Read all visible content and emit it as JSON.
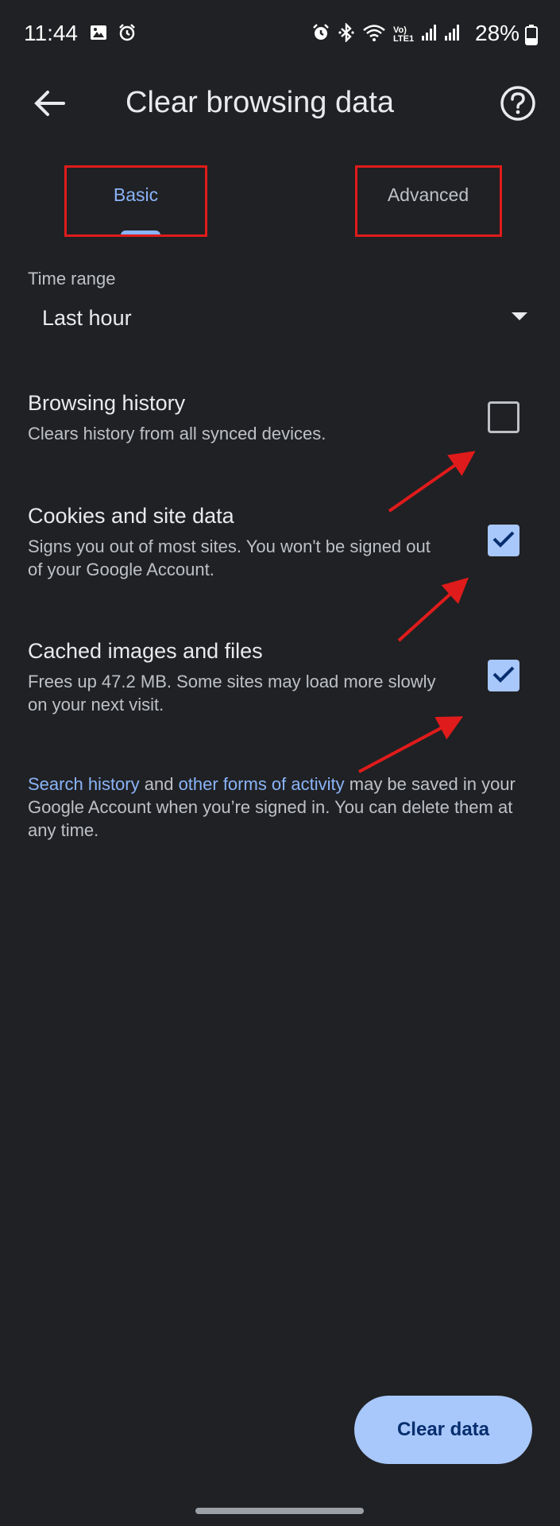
{
  "status_bar": {
    "time": "11:44",
    "battery": "28%",
    "network_label_top": "Vo)",
    "network_label_bottom": "LTE1",
    "left_icons": [
      "image-icon",
      "alarm-icon"
    ],
    "right_icons": [
      "alarm-icon",
      "bluetooth-icon",
      "wifi-icon",
      "signal-icon",
      "signal-icon",
      "battery-icon"
    ]
  },
  "app_bar": {
    "title": "Clear browsing data",
    "back_icon": "arrow-back-icon",
    "help_icon": "help-circle-icon"
  },
  "tabs": [
    {
      "label": "Basic",
      "selected": true
    },
    {
      "label": "Advanced",
      "selected": false
    }
  ],
  "time_range": {
    "label": "Time range",
    "value": "Last hour",
    "dropdown_icon": "dropdown-triangle-icon"
  },
  "options": [
    {
      "title": "Browsing history",
      "description": "Clears history from all synced devices.",
      "checked": false
    },
    {
      "title": "Cookies and site data",
      "description": "Signs you out of most sites. You won't be signed out of your Google Account.",
      "checked": true
    },
    {
      "title": "Cached images and files",
      "description": "Frees up 47.2 MB. Some sites may load more slowly on your next visit.",
      "checked": true
    }
  ],
  "footer_note": {
    "link1": "Search history",
    "text1": " and ",
    "link2": "other forms of activity",
    "text2": " may be saved in your Google Account when you’re signed in. You can delete them at any time."
  },
  "primary_button": {
    "label": "Clear data"
  },
  "colors": {
    "background": "#202124",
    "accent": "#8ab4f8",
    "checkbox_fill": "#a8c7fa",
    "annotation": "#e01b1b"
  }
}
